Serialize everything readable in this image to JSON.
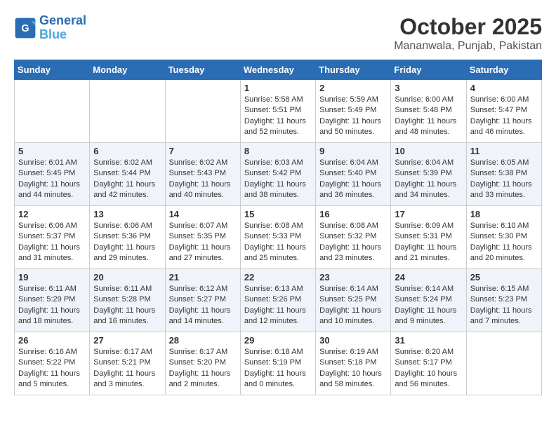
{
  "header": {
    "logo_line1": "General",
    "logo_line2": "Blue",
    "month": "October 2025",
    "location": "Mananwala, Punjab, Pakistan"
  },
  "days_of_week": [
    "Sunday",
    "Monday",
    "Tuesday",
    "Wednesday",
    "Thursday",
    "Friday",
    "Saturday"
  ],
  "weeks": [
    [
      {
        "day": "",
        "info": ""
      },
      {
        "day": "",
        "info": ""
      },
      {
        "day": "",
        "info": ""
      },
      {
        "day": "1",
        "info": "Sunrise: 5:58 AM\nSunset: 5:51 PM\nDaylight: 11 hours and 52 minutes."
      },
      {
        "day": "2",
        "info": "Sunrise: 5:59 AM\nSunset: 5:49 PM\nDaylight: 11 hours and 50 minutes."
      },
      {
        "day": "3",
        "info": "Sunrise: 6:00 AM\nSunset: 5:48 PM\nDaylight: 11 hours and 48 minutes."
      },
      {
        "day": "4",
        "info": "Sunrise: 6:00 AM\nSunset: 5:47 PM\nDaylight: 11 hours and 46 minutes."
      }
    ],
    [
      {
        "day": "5",
        "info": "Sunrise: 6:01 AM\nSunset: 5:45 PM\nDaylight: 11 hours and 44 minutes."
      },
      {
        "day": "6",
        "info": "Sunrise: 6:02 AM\nSunset: 5:44 PM\nDaylight: 11 hours and 42 minutes."
      },
      {
        "day": "7",
        "info": "Sunrise: 6:02 AM\nSunset: 5:43 PM\nDaylight: 11 hours and 40 minutes."
      },
      {
        "day": "8",
        "info": "Sunrise: 6:03 AM\nSunset: 5:42 PM\nDaylight: 11 hours and 38 minutes."
      },
      {
        "day": "9",
        "info": "Sunrise: 6:04 AM\nSunset: 5:40 PM\nDaylight: 11 hours and 36 minutes."
      },
      {
        "day": "10",
        "info": "Sunrise: 6:04 AM\nSunset: 5:39 PM\nDaylight: 11 hours and 34 minutes."
      },
      {
        "day": "11",
        "info": "Sunrise: 6:05 AM\nSunset: 5:38 PM\nDaylight: 11 hours and 33 minutes."
      }
    ],
    [
      {
        "day": "12",
        "info": "Sunrise: 6:06 AM\nSunset: 5:37 PM\nDaylight: 11 hours and 31 minutes."
      },
      {
        "day": "13",
        "info": "Sunrise: 6:06 AM\nSunset: 5:36 PM\nDaylight: 11 hours and 29 minutes."
      },
      {
        "day": "14",
        "info": "Sunrise: 6:07 AM\nSunset: 5:35 PM\nDaylight: 11 hours and 27 minutes."
      },
      {
        "day": "15",
        "info": "Sunrise: 6:08 AM\nSunset: 5:33 PM\nDaylight: 11 hours and 25 minutes."
      },
      {
        "day": "16",
        "info": "Sunrise: 6:08 AM\nSunset: 5:32 PM\nDaylight: 11 hours and 23 minutes."
      },
      {
        "day": "17",
        "info": "Sunrise: 6:09 AM\nSunset: 5:31 PM\nDaylight: 11 hours and 21 minutes."
      },
      {
        "day": "18",
        "info": "Sunrise: 6:10 AM\nSunset: 5:30 PM\nDaylight: 11 hours and 20 minutes."
      }
    ],
    [
      {
        "day": "19",
        "info": "Sunrise: 6:11 AM\nSunset: 5:29 PM\nDaylight: 11 hours and 18 minutes."
      },
      {
        "day": "20",
        "info": "Sunrise: 6:11 AM\nSunset: 5:28 PM\nDaylight: 11 hours and 16 minutes."
      },
      {
        "day": "21",
        "info": "Sunrise: 6:12 AM\nSunset: 5:27 PM\nDaylight: 11 hours and 14 minutes."
      },
      {
        "day": "22",
        "info": "Sunrise: 6:13 AM\nSunset: 5:26 PM\nDaylight: 11 hours and 12 minutes."
      },
      {
        "day": "23",
        "info": "Sunrise: 6:14 AM\nSunset: 5:25 PM\nDaylight: 11 hours and 10 minutes."
      },
      {
        "day": "24",
        "info": "Sunrise: 6:14 AM\nSunset: 5:24 PM\nDaylight: 11 hours and 9 minutes."
      },
      {
        "day": "25",
        "info": "Sunrise: 6:15 AM\nSunset: 5:23 PM\nDaylight: 11 hours and 7 minutes."
      }
    ],
    [
      {
        "day": "26",
        "info": "Sunrise: 6:16 AM\nSunset: 5:22 PM\nDaylight: 11 hours and 5 minutes."
      },
      {
        "day": "27",
        "info": "Sunrise: 6:17 AM\nSunset: 5:21 PM\nDaylight: 11 hours and 3 minutes."
      },
      {
        "day": "28",
        "info": "Sunrise: 6:17 AM\nSunset: 5:20 PM\nDaylight: 11 hours and 2 minutes."
      },
      {
        "day": "29",
        "info": "Sunrise: 6:18 AM\nSunset: 5:19 PM\nDaylight: 11 hours and 0 minutes."
      },
      {
        "day": "30",
        "info": "Sunrise: 6:19 AM\nSunset: 5:18 PM\nDaylight: 10 hours and 58 minutes."
      },
      {
        "day": "31",
        "info": "Sunrise: 6:20 AM\nSunset: 5:17 PM\nDaylight: 10 hours and 56 minutes."
      },
      {
        "day": "",
        "info": ""
      }
    ]
  ]
}
